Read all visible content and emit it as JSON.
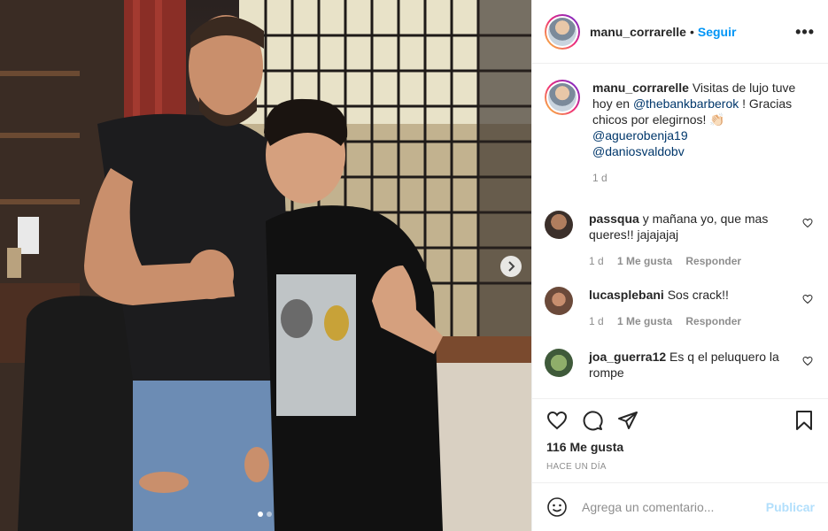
{
  "post": {
    "author": "manu_corrarelle",
    "separator": "•",
    "follow_label": "Seguir",
    "more_label": "•••",
    "caption": {
      "username": "manu_corrarelle",
      "text_1": " Visitas de lujo tuve hoy en ",
      "mention_1": "@thebankbarberok",
      "text_2": " ! Gracias chicos por elegirnos! 👏🏻",
      "mention_2": "@aguerobenja19",
      "mention_3": "@daniosvaldobv",
      "time": "1 d"
    },
    "comments": [
      {
        "username": "passqua",
        "text": " y mañana yo, que mas queres!! jajajajaj",
        "time": "1 d",
        "likes": "1 Me gusta",
        "reply": "Responder"
      },
      {
        "username": "lucasplebani",
        "text": " Sos crack!!",
        "time": "1 d",
        "likes": "1 Me gusta",
        "reply": "Responder"
      },
      {
        "username": "joa_guerra12",
        "text": " Es q el peluquero la rompe"
      }
    ],
    "likes_count": "116 Me gusta",
    "posted_ago": "HACE UN DÍA",
    "comment_placeholder": "Agrega un comentario...",
    "publish_label": "Publicar"
  },
  "colors": {
    "link_blue": "#0095f6",
    "mention_blue": "#00376b",
    "muted_gray": "#8e8e8e",
    "publish_disabled": "#b2dffc"
  },
  "icons": [
    "next-arrow-icon",
    "more-options-icon",
    "like-heart-icon",
    "comment-icon",
    "share-icon",
    "bookmark-icon",
    "emoji-icon",
    "small-heart-icon"
  ]
}
